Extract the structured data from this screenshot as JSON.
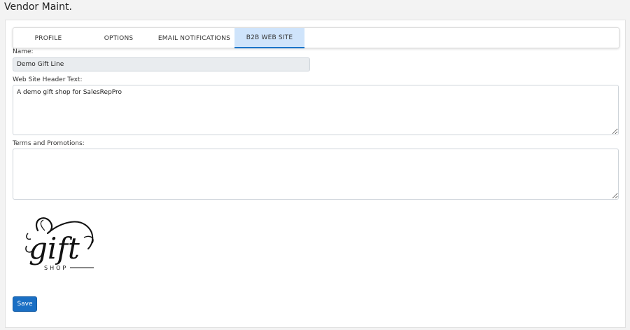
{
  "page": {
    "title": "Vendor Maint."
  },
  "tabs": [
    {
      "label": "PROFILE"
    },
    {
      "label": "OPTIONS"
    },
    {
      "label": "EMAIL NOTIFICATIONS"
    },
    {
      "label": "B2B WEB SITE",
      "active": true
    }
  ],
  "form": {
    "name_label": "Name:",
    "name_value": "Demo Gift Line",
    "header_text_label": "Web Site Header Text:",
    "header_text_value": "A demo gift shop for SalesRepPro",
    "terms_label": "Terms and Promotions:",
    "terms_value": ""
  },
  "logo": {
    "script_text": "gift",
    "sub_text": "SHOP"
  },
  "actions": {
    "save_label": "Save"
  },
  "colors": {
    "accent": "#1a6fc4",
    "active_tab_bg": "#cfe4fb",
    "readonly_bg": "#e9ecef"
  }
}
